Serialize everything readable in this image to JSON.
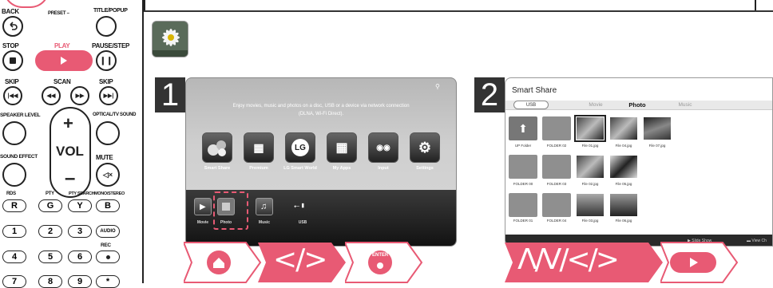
{
  "remote": {
    "labels": {
      "back": "BACK",
      "preset": "PRESET –",
      "title_popup": "TITLE/POPUP",
      "stop": "STOP",
      "play": "PLAY",
      "pause_step": "PAUSE/STEP",
      "skip_left": "SKIP",
      "scan": "SCAN",
      "skip_right": "SKIP",
      "speaker_level": "SPEAKER LEVEL",
      "optical_tv_sound": "OPTICAL/TV SOUND",
      "sound_effect": "SOUND EFFECT",
      "vol": "VOL",
      "mute": "MUTE",
      "rds": "RDS",
      "pty": "PTY",
      "pty_search": "PTY SEARCH",
      "mono_stereo": "MONO/STEREO",
      "rec": "REC"
    },
    "color_keys": [
      "R",
      "G",
      "Y",
      "B"
    ],
    "numpad_row1": [
      "1",
      "2",
      "3",
      "AUDIO"
    ],
    "numpad_row2": [
      "4",
      "5",
      "6"
    ],
    "numpad_row3": [
      "7",
      "8",
      "9",
      "*"
    ]
  },
  "steps": {
    "step1_number": "1",
    "step2_number": "2"
  },
  "home_screen": {
    "message": "Enjoy movies, music and photos on a disc, USB or a device via network connection (DLNA, Wi-Fi Direct).",
    "apps": [
      "Smart Share",
      "Premium",
      "LG Smart World",
      "My Apps",
      "Input",
      "Settings"
    ],
    "lg_logo_text": "LG",
    "dock": [
      "Movie",
      "Photo",
      "Music",
      "USB"
    ]
  },
  "smart_share": {
    "title": "Smart Share",
    "source": "USB",
    "tabs": [
      "Movie",
      "Photo",
      "Music"
    ],
    "selected_tab": "Photo",
    "items_row1": [
      "UP Folder",
      "FOLDER 02",
      "File 01.jpg",
      "File 04.jpg",
      "File 07.jpg"
    ],
    "items_row2": [
      "FOLDER 00",
      "FOLDER 03",
      "File 02.jpg",
      "File 05.jpg"
    ],
    "items_row3": [
      "FOLDER 01",
      "FOLDER 04",
      "File 03.jpg",
      "File 06.jpg"
    ],
    "bottom_actions": [
      "Slide Show",
      "View Ch"
    ]
  },
  "nav_sequence": {
    "arrows1": "</>",
    "enter_label": "ENTER",
    "arrows2": "Λ/V/</>"
  },
  "colors": {
    "accent": "#e85a74",
    "dark": "#333333"
  }
}
